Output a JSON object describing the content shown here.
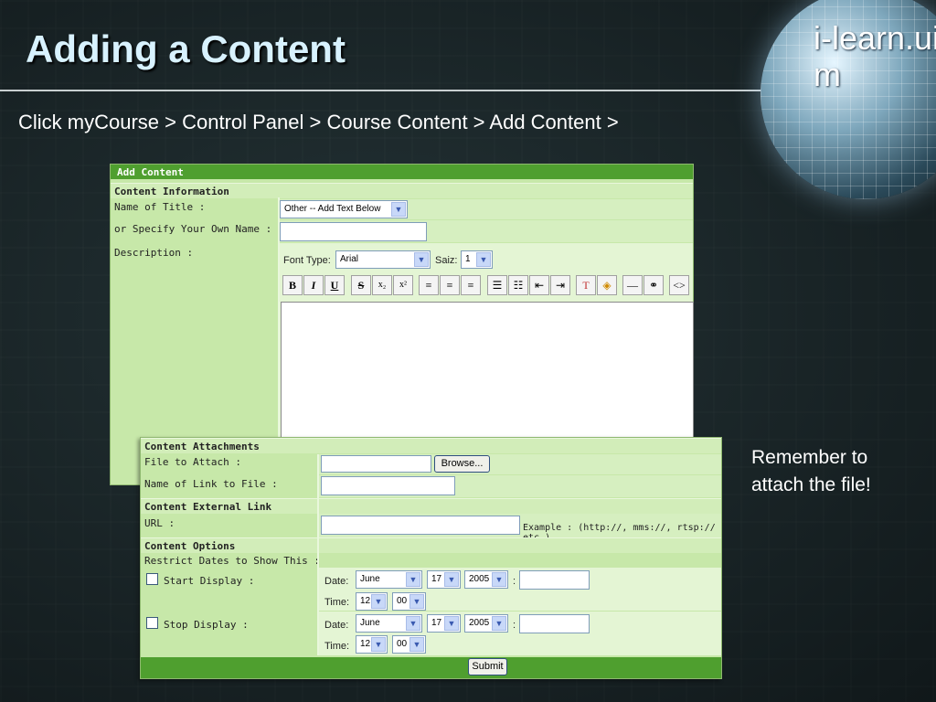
{
  "slide": {
    "title": "Adding a Content",
    "brand": "i-learn.uitm",
    "breadcrumb": "Click myCourse > Control Panel > Course Content > Add Content >",
    "note_line1": "Remember to",
    "note_line2": "attach the file!"
  },
  "add_content": {
    "header": "Add Content",
    "section": "Content Information",
    "name_of_title_label": "Name of Title :",
    "name_of_title_value": "Other -- Add Text Below",
    "own_name_label": "or Specify Your Own Name :",
    "description_label": "Description :",
    "font_type_label": "Font Type:",
    "font_type_value": "Arial",
    "size_label": "Saiz:",
    "size_value": "1",
    "toolbar": {
      "bold": "B",
      "italic": "I",
      "underline": "U",
      "strike": "S",
      "subscript": "x₂",
      "superscript": "x²",
      "hr": "—",
      "link": "⚭",
      "source": "<>"
    }
  },
  "attachments": {
    "section": "Content Attachments",
    "file_label": "File to Attach :",
    "browse_button": "Browse...",
    "link_name_label": "Name of Link to File :"
  },
  "external_link": {
    "section": "Content External Link",
    "url_label": "URL :",
    "example": "Example : (http://, mms://, rtsp:// etc.)"
  },
  "options": {
    "section": "Content Options",
    "restrict_label": "Restrict Dates to Show This :",
    "start_label": "Start Display :",
    "stop_label": "Stop Display :",
    "date_label": "Date:",
    "time_label": "Time:",
    "colon": ":",
    "month": "June",
    "day": "17",
    "year": "2005",
    "hour": "12",
    "minute": "00"
  },
  "submit_button": "Submit"
}
